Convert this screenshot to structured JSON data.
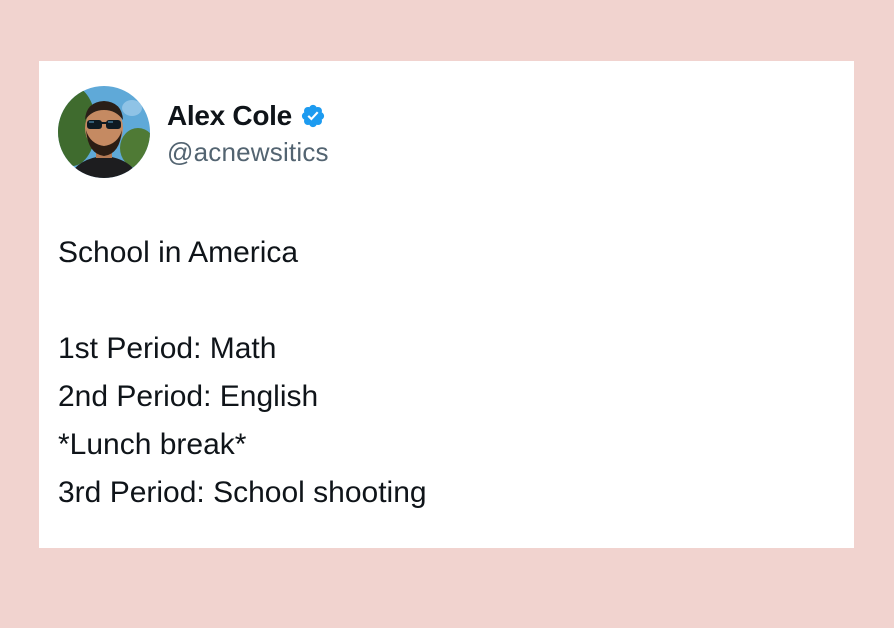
{
  "tweet": {
    "author": {
      "display_name": "Alex Cole",
      "handle": "@acnewsitics",
      "verified": true
    },
    "text": {
      "title_line": "School in America",
      "lines": [
        "1st Period: Math",
        "2nd Period: English",
        "*Lunch break*",
        "3rd Period: School shooting"
      ]
    }
  },
  "colors": {
    "background": "#f1d3cf",
    "card": "#ffffff",
    "verified_badge": "#1d9bf0",
    "handle_text": "#536471",
    "body_text": "#0f1419"
  },
  "icons": {
    "verified": "verified-badge-icon",
    "avatar": "user-avatar"
  }
}
